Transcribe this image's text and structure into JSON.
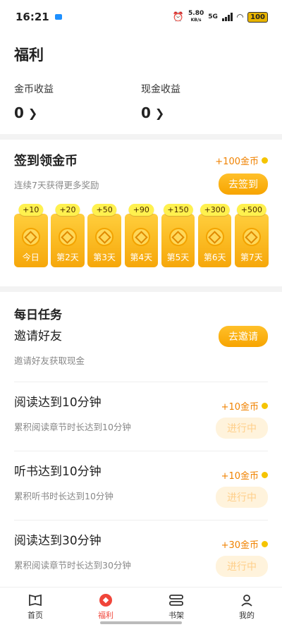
{
  "status_bar": {
    "time": "16:21",
    "net_speed_value": "5.80",
    "net_speed_unit": "KB/s",
    "network": "5G",
    "battery": "100"
  },
  "page": {
    "title": "福利"
  },
  "earnings": {
    "coin_label": "金币收益",
    "coin_value": "0",
    "cash_label": "现金收益",
    "cash_value": "0"
  },
  "signin": {
    "title": "签到领金币",
    "subtitle": "连续7天获得更多奖励",
    "reward": "+100金币",
    "button": "去签到",
    "days": [
      {
        "bonus": "+10",
        "label": "今日"
      },
      {
        "bonus": "+20",
        "label": "第2天"
      },
      {
        "bonus": "+50",
        "label": "第3天"
      },
      {
        "bonus": "+90",
        "label": "第4天"
      },
      {
        "bonus": "+150",
        "label": "第5天"
      },
      {
        "bonus": "+300",
        "label": "第6天"
      },
      {
        "bonus": "+500",
        "label": "第7天"
      }
    ]
  },
  "tasks": {
    "title": "每日任务",
    "items": [
      {
        "name": "邀请好友",
        "desc": "邀请好友获取现金",
        "reward": "",
        "button": "去邀请"
      },
      {
        "name": "阅读达到10分钟",
        "desc": "累积阅读章节时长达到10分钟",
        "reward": "+10金币",
        "button": "进行中"
      },
      {
        "name": "听书达到10分钟",
        "desc": "累积听书时长达到10分钟",
        "reward": "+10金币",
        "button": "进行中"
      },
      {
        "name": "阅读达到30分钟",
        "desc": "累积阅读章节时长达到30分钟",
        "reward": "+30金币",
        "button": "进行中"
      }
    ]
  },
  "tabbar": {
    "items": [
      {
        "label": "首页",
        "icon": "book-icon"
      },
      {
        "label": "福利",
        "icon": "gift-icon"
      },
      {
        "label": "书架",
        "icon": "bookshelf-icon"
      },
      {
        "label": "我的",
        "icon": "profile-icon"
      }
    ],
    "active": "福利",
    "active_color": "#f0453a"
  },
  "colors": {
    "accent": "#f7a400",
    "reward_text": "#f08200"
  }
}
